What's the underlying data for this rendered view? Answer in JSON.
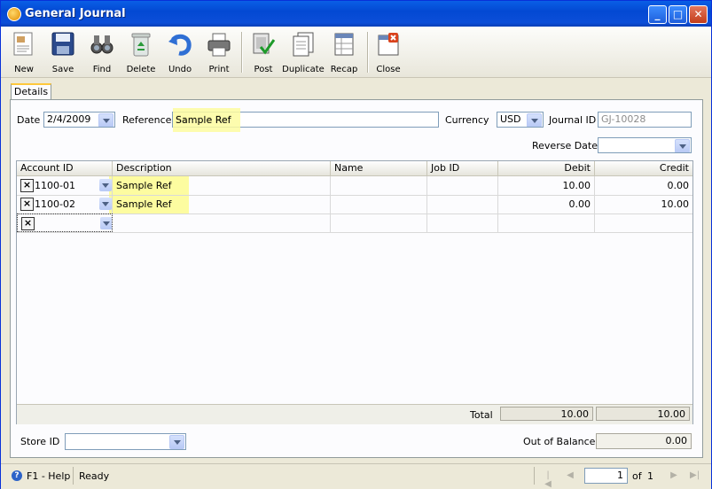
{
  "window": {
    "title": "General Journal"
  },
  "toolbar": [
    {
      "id": "new",
      "label": "New",
      "icon": "new-document-icon"
    },
    {
      "id": "save",
      "label": "Save",
      "icon": "floppy-disk-icon"
    },
    {
      "id": "find",
      "label": "Find",
      "icon": "binoculars-icon"
    },
    {
      "id": "delete",
      "label": "Delete",
      "icon": "recycle-bin-icon"
    },
    {
      "id": "undo",
      "label": "Undo",
      "icon": "undo-arrow-icon"
    },
    {
      "id": "print",
      "label": "Print",
      "icon": "printer-icon"
    },
    {
      "id": "post",
      "label": "Post",
      "icon": "post-checkmark-icon"
    },
    {
      "id": "duplicate",
      "label": "Duplicate",
      "icon": "duplicate-pages-icon"
    },
    {
      "id": "recap",
      "label": "Recap",
      "icon": "recap-table-icon"
    },
    {
      "id": "close",
      "label": "Close",
      "icon": "close-window-icon"
    }
  ],
  "tabs": {
    "details": "Details"
  },
  "form": {
    "date_label": "Date",
    "date_value": "2/4/2009",
    "reference_label": "Reference",
    "reference_value": "Sample Ref",
    "currency_label": "Currency",
    "currency_value": "USD",
    "journal_id_label": "Journal ID",
    "journal_id_value": "GJ-10028",
    "reverse_date_label": "Reverse Date",
    "reverse_date_value": ""
  },
  "grid": {
    "columns": [
      "Account ID",
      "Description",
      "Name",
      "Job ID",
      "Debit",
      "Credit"
    ],
    "rows": [
      {
        "account": "1100-01",
        "description": "Sample Ref",
        "name": "",
        "job": "",
        "debit": "10.00",
        "credit": "0.00"
      },
      {
        "account": "1100-02",
        "description": "Sample Ref",
        "name": "",
        "job": "",
        "debit": "0.00",
        "credit": "10.00"
      }
    ],
    "new_row_delete": "×",
    "total_label": "Total",
    "total_debit": "10.00",
    "total_credit": "10.00"
  },
  "footer": {
    "store_label": "Store ID",
    "store_value": "",
    "out_of_balance_label": "Out of Balance",
    "out_of_balance_value": "0.00"
  },
  "status": {
    "help": "F1 - Help",
    "text": "Ready",
    "page": "1",
    "of_label": "of",
    "page_count": "1"
  },
  "colors": {
    "highlight": "#fdfca0",
    "titlebar": "#0a5fe6"
  }
}
